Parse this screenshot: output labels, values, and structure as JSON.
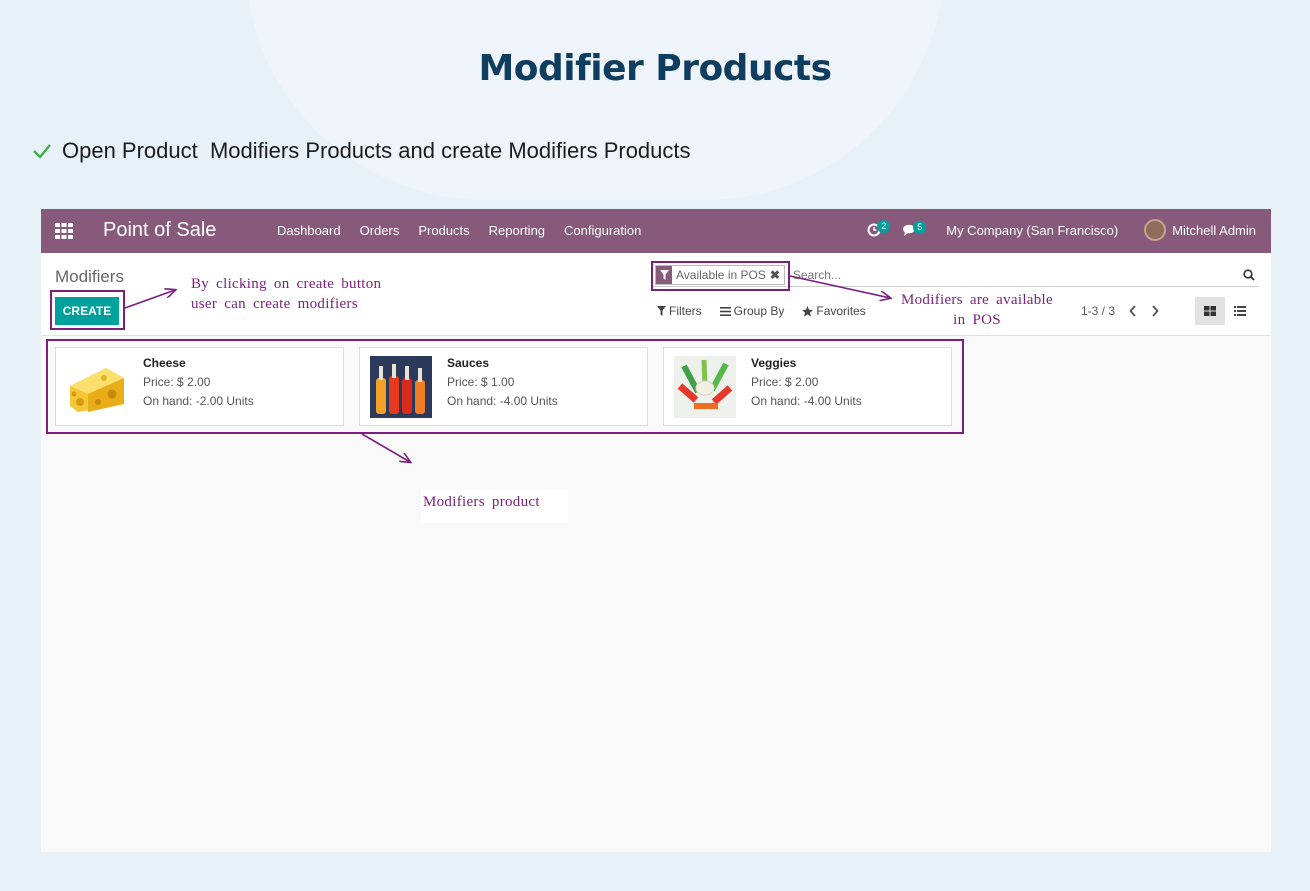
{
  "heading": "Modifier Products",
  "bullet_text": "Open Product  Modifiers Products and create Modifiers Products",
  "navbar": {
    "app_name": "Point of Sale",
    "menu": [
      "Dashboard",
      "Orders",
      "Products",
      "Reporting",
      "Configuration"
    ],
    "activity_count": "2",
    "message_count": "5",
    "company": "My Company (San Francisco)",
    "user": "Mitchell Admin"
  },
  "control_panel": {
    "breadcrumb": "Modifiers",
    "create_label": "CREATE",
    "facet_label": "Available in POS",
    "facet_close": "✖",
    "search_placeholder": "Search...",
    "filters_label": "Filters",
    "groupby_label": "Group By",
    "favorites_label": "Favorites",
    "pager": "1-3 / 3"
  },
  "products": [
    {
      "name": "Cheese",
      "price": "Price: $ 2.00",
      "on_hand": "On hand: -2.00 Units",
      "icon": "cheese-image"
    },
    {
      "name": "Sauces",
      "price": "Price: $ 1.00",
      "on_hand": "On hand: -4.00 Units",
      "icon": "sauce-bottles-image"
    },
    {
      "name": "Veggies",
      "price": "Price: $ 2.00",
      "on_hand": "On hand: -4.00 Units",
      "icon": "veggies-image"
    }
  ],
  "annotations": {
    "create_note_line1": "By clicking on create button",
    "create_note_line2": "user can create modifiers",
    "pos_note_line1": "Modifiers are available",
    "pos_note_line2": "in POS",
    "product_note": "Modifiers product"
  },
  "colors": {
    "navbar": "#875a7b",
    "primary_button": "#00a09d",
    "annotation": "#7b1f7f",
    "heading": "#0f3d5f"
  }
}
